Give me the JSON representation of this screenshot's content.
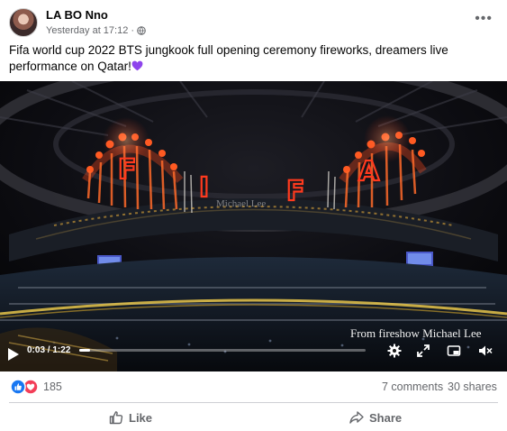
{
  "post": {
    "author": "LA BO Nno",
    "timestamp": "Yesterday at 17:12",
    "separator": "·",
    "more_icon": "more-horizontal-icon",
    "caption": "Fifa world cup 2022 BTS jungkook full opening ceremony fireworks, dreamers live performance on Qatar!",
    "caption_emoji": "purple-heart"
  },
  "video": {
    "scene_text": {
      "fireworks_letters": [
        "F",
        "I",
        "F",
        "A"
      ],
      "watermark": "Michael Lee",
      "credit": "From fireshow Michael Lee"
    },
    "current_time": "0:03",
    "duration": "1:22",
    "time_display": "0:03 / 1:22",
    "progress_fraction": 0.037,
    "controls": [
      "play-icon",
      "settings-gear-icon",
      "fullscreen-expand-icon",
      "picture-in-picture-icon",
      "volume-muted-icon"
    ]
  },
  "engagement": {
    "reaction_icons": [
      "like-reaction-icon",
      "love-reaction-icon"
    ],
    "reaction_count": "185",
    "comments": "7 comments",
    "shares": "30 shares"
  },
  "actions": {
    "like_label": "Like",
    "share_label": "Share"
  },
  "colors": {
    "like_blue": "#1877f2",
    "love_red": "#f33e58",
    "secondary_text": "#65676b",
    "purple_heart": "#8e44ec"
  }
}
